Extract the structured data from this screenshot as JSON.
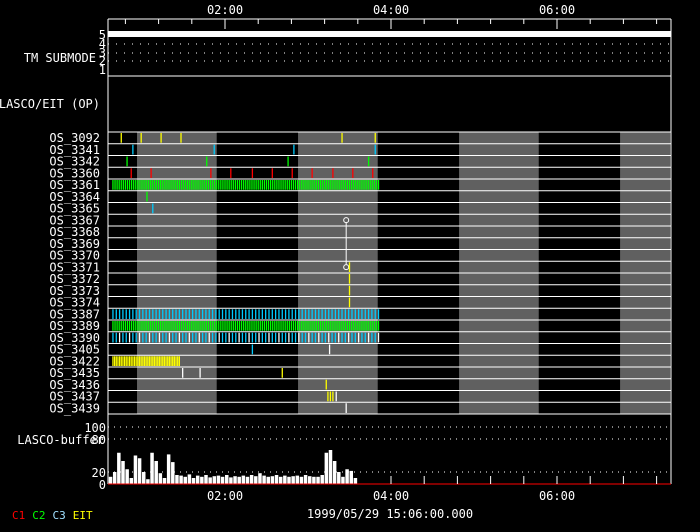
{
  "chart_data": {
    "type": "timeline",
    "date_label": "1999/05/29 15:06:00.000",
    "x_range_hours": [
      0.59,
      7.37
    ],
    "x_ticks": [
      {
        "h": 2,
        "label": "02:00"
      },
      {
        "h": 4,
        "label": "04:00"
      },
      {
        "h": 6,
        "label": "06:00"
      }
    ],
    "gray_bands_hours": [
      [
        0.94,
        1.9
      ],
      [
        2.88,
        3.84
      ],
      [
        4.82,
        5.78
      ],
      [
        6.76,
        7.37
      ]
    ],
    "tm_submode": {
      "label": "TM SUBMODE",
      "levels": [
        "5",
        "4",
        "3",
        "2",
        "1"
      ],
      "value": 5
    },
    "op_panel": {
      "label": "LASCO/EIT (OP)"
    },
    "rows": [
      {
        "name": "OS_3092",
        "events": [
          {
            "h": 0.75,
            "c": "EIT"
          },
          {
            "h": 0.99,
            "c": "EIT"
          },
          {
            "h": 1.23,
            "c": "EIT"
          },
          {
            "h": 1.47,
            "c": "EIT"
          },
          {
            "h": 3.41,
            "c": "EIT"
          },
          {
            "h": 3.81,
            "c": "EIT"
          }
        ]
      },
      {
        "name": "OS_3341",
        "events": [
          {
            "h": 0.89,
            "c": "C3"
          },
          {
            "h": 1.87,
            "c": "C3"
          },
          {
            "h": 2.83,
            "c": "C3"
          },
          {
            "h": 3.81,
            "c": "C3"
          }
        ]
      },
      {
        "name": "OS_3342",
        "events": [
          {
            "h": 0.82,
            "c": "C2"
          },
          {
            "h": 1.78,
            "c": "C2"
          },
          {
            "h": 2.76,
            "c": "C2"
          },
          {
            "h": 3.73,
            "c": "C2"
          }
        ]
      },
      {
        "name": "OS_3360",
        "events": [
          {
            "h": 0.87,
            "c": "C1"
          },
          {
            "h": 1.11,
            "c": "C1"
          },
          {
            "h": 1.83,
            "c": "C1"
          },
          {
            "h": 2.07,
            "c": "C1"
          },
          {
            "h": 2.33,
            "c": "C1"
          },
          {
            "h": 2.57,
            "c": "C1"
          },
          {
            "h": 2.81,
            "c": "C1"
          },
          {
            "h": 3.05,
            "c": "C1"
          },
          {
            "h": 3.3,
            "c": "C1"
          },
          {
            "h": 3.54,
            "c": "C1"
          },
          {
            "h": 3.78,
            "c": "C1"
          }
        ]
      },
      {
        "name": "OS_3361",
        "dense": {
          "from": 0.65,
          "to": 3.87,
          "step": 0.025,
          "c": "C2"
        }
      },
      {
        "name": "OS_3364",
        "events": [
          {
            "h": 1.06,
            "c": "C2"
          }
        ]
      },
      {
        "name": "OS_3365",
        "events": [
          {
            "h": 1.13,
            "c": "C3"
          }
        ]
      },
      {
        "name": "OS_3367",
        "events": [
          {
            "h": 3.46,
            "c": "OTHER",
            "marker": "circle"
          }
        ]
      },
      {
        "name": "OS_3368",
        "events": []
      },
      {
        "name": "OS_3369",
        "events": []
      },
      {
        "name": "OS_3370",
        "events": []
      },
      {
        "name": "OS_3371",
        "events": [
          {
            "h": 3.46,
            "c": "OTHER",
            "marker": "circle"
          },
          {
            "h": 3.5,
            "c": "EIT"
          }
        ]
      },
      {
        "name": "OS_3372",
        "events": [
          {
            "h": 3.5,
            "c": "EIT"
          }
        ]
      },
      {
        "name": "OS_3373",
        "events": [
          {
            "h": 3.5,
            "c": "EIT"
          }
        ]
      },
      {
        "name": "OS_3374",
        "events": [
          {
            "h": 3.5,
            "c": "EIT"
          }
        ]
      },
      {
        "name": "OS_3387",
        "dense": {
          "from": 0.65,
          "to": 3.87,
          "step": 0.04,
          "c": "C3"
        }
      },
      {
        "name": "OS_3389",
        "dense": {
          "from": 0.65,
          "to": 3.87,
          "step": 0.025,
          "c": "C2"
        }
      },
      {
        "name": "OS_3390",
        "dense": {
          "from": 0.65,
          "to": 3.87,
          "step": 0.04,
          "c": "C3"
        }
      },
      {
        "name": "OS_3405",
        "events": [
          {
            "h": 2.33,
            "c": "C3"
          },
          {
            "h": 3.26,
            "c": "OTHER"
          }
        ]
      },
      {
        "name": "OS_3422",
        "dense": {
          "from": 0.65,
          "to": 1.47,
          "step": 0.02,
          "c": "EIT"
        }
      },
      {
        "name": "OS_3435",
        "events": [
          {
            "h": 1.49,
            "c": "OTHER"
          },
          {
            "h": 1.7,
            "c": "OTHER"
          },
          {
            "h": 2.69,
            "c": "EIT"
          }
        ]
      },
      {
        "name": "OS_3436",
        "events": [
          {
            "h": 3.22,
            "c": "EIT"
          }
        ]
      },
      {
        "name": "OS_3437",
        "events": [
          {
            "h": 3.24,
            "c": "EIT"
          },
          {
            "h": 3.27,
            "c": "EIT"
          },
          {
            "h": 3.3,
            "c": "EIT"
          },
          {
            "h": 3.34,
            "c": "OTHER"
          }
        ]
      },
      {
        "name": "OS_3439",
        "events": [
          {
            "h": 3.46,
            "c": "OTHER"
          }
        ]
      }
    ],
    "buffer": {
      "label": "LASCO-buffer",
      "y_ticks": [
        "100",
        "80",
        "20",
        "0"
      ],
      "start_h": 0.6,
      "step_h": 0.05,
      "values": [
        12,
        20,
        55,
        40,
        25,
        10,
        50,
        45,
        20,
        8,
        55,
        40,
        18,
        10,
        52,
        38,
        15,
        14,
        12,
        16,
        10,
        14,
        12,
        15,
        11,
        13,
        14,
        12,
        15,
        11,
        13,
        12,
        14,
        12,
        15,
        13,
        18,
        14,
        12,
        13,
        15,
        12,
        14,
        12,
        13,
        14,
        12,
        15,
        13,
        12,
        12,
        15,
        55,
        60,
        40,
        20,
        12,
        25,
        22,
        10
      ]
    },
    "legend": [
      {
        "key": "C1",
        "color": "#ff0000"
      },
      {
        "key": "C2",
        "color": "#00ff00"
      },
      {
        "key": "C3",
        "color": "#a0e0ff"
      },
      {
        "key": "EIT",
        "color": "#ffff00"
      }
    ],
    "colors": {
      "C1": "#ff0000",
      "C2": "#00ff00",
      "C3": "#00ccff",
      "EIT": "#ffff00",
      "OTHER": "#ffffff",
      "band": "#606060"
    }
  }
}
